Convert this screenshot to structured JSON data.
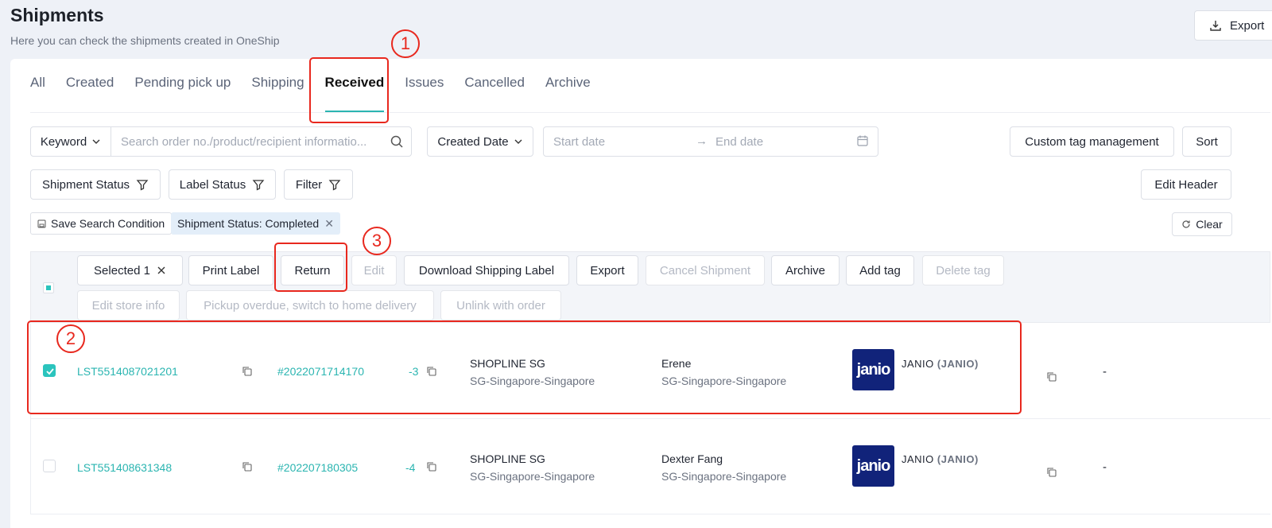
{
  "page": {
    "title": "Shipments",
    "subtitle": "Here you can check the shipments created in OneShip",
    "export_label": "Export"
  },
  "tabs": [
    {
      "label": "All"
    },
    {
      "label": "Created"
    },
    {
      "label": "Pending pick up"
    },
    {
      "label": "Shipping"
    },
    {
      "label": "Received",
      "active": true
    },
    {
      "label": "Issues"
    },
    {
      "label": "Cancelled"
    },
    {
      "label": "Archive"
    }
  ],
  "search": {
    "keyword_label": "Keyword",
    "placeholder": "Search order no./product/recipient informatio...",
    "date_type": "Created Date",
    "start_placeholder": "Start date",
    "arrow": "→",
    "end_placeholder": "End date"
  },
  "toolbar": {
    "custom_tag": "Custom tag management",
    "sort": "Sort",
    "shipment_status": "Shipment Status",
    "label_status": "Label Status",
    "filter": "Filter",
    "edit_header": "Edit Header",
    "save_search": "Save Search Condition",
    "status_chip_key": "Shipment Status:",
    "status_chip_value": "Completed",
    "clear": "Clear"
  },
  "batch": {
    "selected": "Selected 1",
    "print_label": "Print Label",
    "return": "Return",
    "edit": "Edit",
    "download": "Download Shipping Label",
    "export": "Export",
    "cancel": "Cancel Shipment",
    "archive": "Archive",
    "add_tag": "Add tag",
    "delete_tag": "Delete tag",
    "edit_store": "Edit store info",
    "pickup_overdue": "Pickup overdue, switch to home delivery",
    "unlink": "Unlink with order"
  },
  "rows": [
    {
      "checked": true,
      "shipment_no": "LST5514087021201",
      "order_no": "#2022071714170",
      "order_suffix": "-3",
      "store": "SHOPLINE SG",
      "store_location": "SG-Singapore-Singapore",
      "recipient": "Erene",
      "recipient_location": "SG-Singapore-Singapore",
      "logo_text": "janio",
      "carrier": "JANIO",
      "carrier_code": "(JANIO)",
      "last": "-"
    },
    {
      "checked": false,
      "shipment_no": "LST551408631348",
      "order_no": "#202207180305",
      "order_suffix": "-4",
      "store": "SHOPLINE SG",
      "store_location": "SG-Singapore-Singapore",
      "recipient": "Dexter Fang",
      "recipient_location": "SG-Singapore-Singapore",
      "logo_text": "janio",
      "carrier": "JANIO",
      "carrier_code": "(JANIO)",
      "last": "-"
    }
  ],
  "annotations": [
    "1",
    "2",
    "3"
  ],
  "colors": {
    "accent": "#2bb5b1",
    "highlight": "#e8281e",
    "logo_bg": "#11237a"
  }
}
